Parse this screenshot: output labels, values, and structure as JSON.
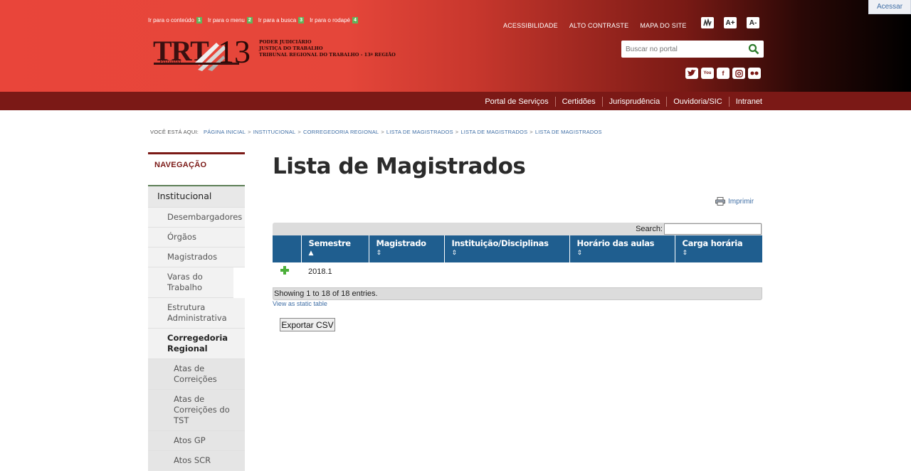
{
  "header": {
    "skiplinks": [
      {
        "label": "Ir para o conteúdo",
        "key": "1"
      },
      {
        "label": "Ir para o menu",
        "key": "2"
      },
      {
        "label": "Ir para a busca",
        "key": "3"
      },
      {
        "label": "Ir para o rodapé",
        "key": "4"
      }
    ],
    "logo": {
      "trt": "TRT",
      "num": "13",
      "state": "Paraíba"
    },
    "institution": [
      "PODER JUDICIÁRIO",
      "JUSTIÇA DO TRABALHO",
      "TRIBUNAL REGIONAL DO TRABALHO - 13ª REGIÃO"
    ],
    "toplinks": [
      "ACESSIBILIDADE",
      "ALTO CONTRASTE",
      "MAPA DO SITE"
    ],
    "tools": {
      "libras_icon": "hands-icon",
      "font_up": "A+",
      "font_down": "A-"
    },
    "search_placeholder": "Buscar no portal",
    "social": [
      "twitter-icon",
      "youtube-icon",
      "facebook-icon",
      "instagram-icon",
      "flickr-icon"
    ],
    "acessar": "Acessar",
    "nav": [
      "Portal de Serviços",
      "Certidões",
      "Jurisprudência",
      "Ouvidoria/SIC",
      "Intranet"
    ]
  },
  "breadcrumb": {
    "label": "VOCÊ ESTÁ AQUI:",
    "items": [
      "PÁGINA INICIAL",
      "INSTITUCIONAL",
      "CORREGEDORIA REGIONAL",
      "LISTA DE MAGISTRADOS",
      "LISTA DE MAGISTRADOS",
      "LISTA DE MAGISTRADOS"
    ]
  },
  "sidebar": {
    "title": "NAVEGAÇÃO",
    "top": "Institucional",
    "items": [
      "Desembargadores",
      "Órgãos",
      "Magistrados",
      "Varas do Trabalho",
      "Estrutura Administrativa",
      "Corregedoria Regional"
    ],
    "subitems": [
      "Atas de Correições",
      "Atas de Correições do TST",
      "Atos GP",
      "Atos SCR"
    ]
  },
  "main": {
    "title": "Lista de Magistrados",
    "print": "Imprimir",
    "search_label": "Search:",
    "columns": [
      "Semestre",
      "Magistrado",
      "Instituição/Disciplinas",
      "Horário das aulas",
      "Carga horária"
    ],
    "rows": [
      {
        "semestre": "2018.1"
      }
    ],
    "info": "Showing 1 to 18 of 18 entries.",
    "static_link": "View as static table",
    "export": "Exportar CSV"
  },
  "colors": {
    "header_red": "#e9453a",
    "nav_dark_red": "#7b1916",
    "table_head": "#1f5e8f",
    "link": "#3f6ea5"
  }
}
